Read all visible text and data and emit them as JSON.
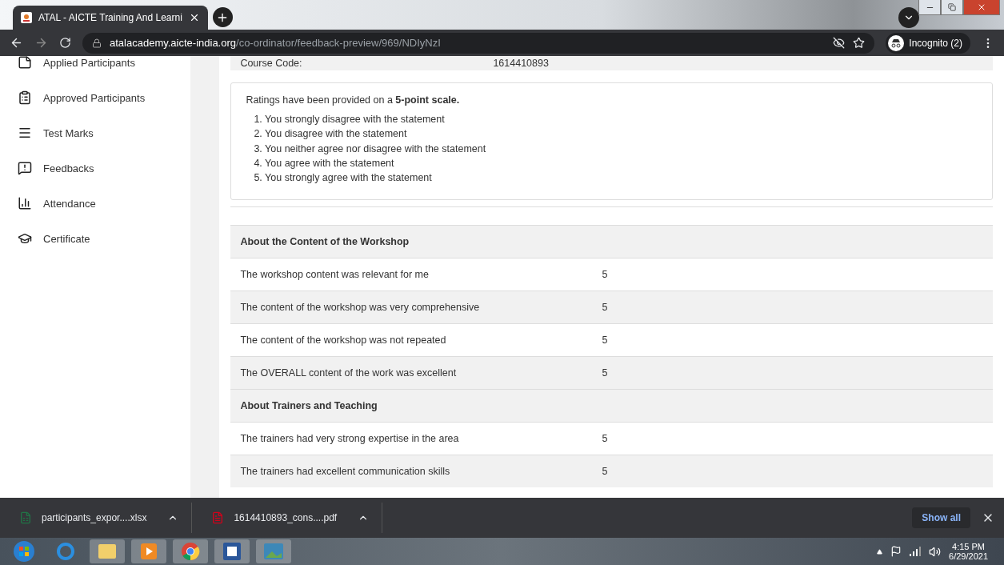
{
  "browser": {
    "tab": {
      "title": "ATAL - AICTE Training And Learni"
    },
    "url": {
      "host": "atalacademy.aicte-india.org",
      "path": "/co-ordinator/feedback-preview/969/NDIyNzI"
    },
    "profile": "Incognito (2)"
  },
  "sidebar": {
    "items": [
      {
        "label": "Applied Participants"
      },
      {
        "label": "Approved Participants"
      },
      {
        "label": "Test Marks"
      },
      {
        "label": "Feedbacks"
      },
      {
        "label": "Attendance"
      },
      {
        "label": "Certificate"
      }
    ]
  },
  "course": {
    "label": "Course Code:",
    "value": "1614410893"
  },
  "scale_note": {
    "intro": "Ratings have been provided on a **5-point scale.**",
    "items": [
      "1. You strongly disagree with the statement",
      "2. You disagree with the statement",
      "3. You neither agree nor disagree with the statement",
      "4. You agree with the statement",
      "5. You strongly agree with the statement"
    ]
  },
  "feedback_rows": [
    {
      "kind": "heading",
      "text": "About the Content of the Workshop"
    },
    {
      "kind": "rating",
      "text": "The workshop content was relevant for me",
      "score": "5"
    },
    {
      "kind": "rating",
      "text": "The content of the workshop was very comprehensive",
      "score": "5"
    },
    {
      "kind": "rating",
      "text": "The content of the workshop was not repeated",
      "score": "5"
    },
    {
      "kind": "rating",
      "text": "The OVERALL content of the work was excellent",
      "score": "5"
    },
    {
      "kind": "heading",
      "text": "About Trainers and Teaching"
    },
    {
      "kind": "rating",
      "text": "The trainers had very strong expertise in the area",
      "score": "5"
    },
    {
      "kind": "rating",
      "text": "The trainers had excellent communication skills",
      "score": "5"
    }
  ],
  "downloads": {
    "items": [
      {
        "name": "participants_expor....xlsx"
      },
      {
        "name": "1614410893_cons....pdf"
      }
    ],
    "show_all": "Show all"
  },
  "taskbar": {
    "time": "4:15 PM",
    "date": "6/29/2021"
  }
}
